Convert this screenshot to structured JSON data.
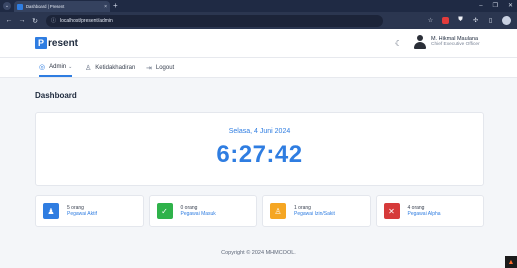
{
  "browser": {
    "tab_title": "Dashboard | Present",
    "tab_close": "×",
    "new_tab": "+",
    "address": "localhost/present/admin",
    "window_controls": {
      "minimize": "–",
      "maximize": "❐",
      "close": "✕"
    },
    "nav": {
      "back": "←",
      "forward": "→",
      "reload": "↻"
    },
    "extensions": [
      "star-icon",
      "extension-red-icon",
      "shield-icon",
      "extensions-icon",
      "sidebar-icon",
      "profile-icon"
    ]
  },
  "header": {
    "brand_mark": "P",
    "brand_text": "resent",
    "theme_icon": "☾",
    "user_name": "M. Hikmal Maulana",
    "user_role": "Chief Executive Officer"
  },
  "subnav": {
    "admin": "Admin",
    "admin_chevron": "⌄",
    "ketidakhadiran": "Ketidakhadiran",
    "logout": "Logout"
  },
  "dashboard": {
    "title": "Dashboard",
    "date": "Selasa, 4 Juni 2024",
    "time": "6:27:42"
  },
  "stats": [
    {
      "count": "5 orang",
      "label": "Pegawai Aktif",
      "color": "#2f7de1",
      "icon": "users-icon"
    },
    {
      "count": "0 orang",
      "label": "Pegawai Masuk",
      "color": "#2fb24a",
      "icon": "user-check-icon"
    },
    {
      "count": "1 orang",
      "label": "Pegawai Izin/Sakit",
      "color": "#f5a623",
      "icon": "user-clock-icon"
    },
    {
      "count": "4 orang",
      "label": "Pegawai Alpha",
      "color": "#d63a3a",
      "icon": "user-x-icon"
    }
  ],
  "footer": "Copyright © 2024 MHMCOOL."
}
